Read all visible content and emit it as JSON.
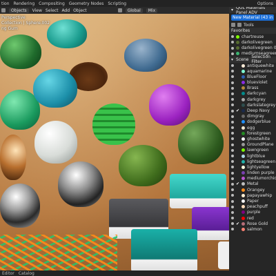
{
  "topbar": {
    "items": [
      "tion",
      "Rendering",
      "Compositing",
      "Geometry Nodes",
      "Scripting"
    ],
    "right": "Options"
  },
  "toolbar": {
    "mode": "Objects",
    "menus": [
      "View",
      "Select",
      "Add",
      "Object"
    ],
    "transform": "Global",
    "pivot": "Mix"
  },
  "viewport": {
    "view_name": "Perspective",
    "collection": "Collection | Sphere.002",
    "extra": "ng Gum"
  },
  "sidebar": {
    "panel_title": "QOL Materials Panel ADV",
    "new_material": "New Material (43 in scene)",
    "tools_label": "Tools",
    "favorites_label": "Favorites",
    "favorites": [
      {
        "name": "chartreuse",
        "color": "#7fff00"
      },
      {
        "name": "darkolivegreen",
        "color": "#556b2f"
      },
      {
        "name": "darkolivegreen 001",
        "color": "#556b2f"
      },
      {
        "name": "mediumseagreen",
        "color": "#3cb371"
      }
    ],
    "scene_label": "Scene",
    "filter_label": "Selection Filter",
    "materials": [
      {
        "name": "antiquewhite",
        "color": "#faebd7",
        "checked": false
      },
      {
        "name": "aquamarine",
        "color": "#7fffd4",
        "checked": false
      },
      {
        "name": "BlueFloor",
        "color": "#2f5fb0",
        "checked": false
      },
      {
        "name": "blueviolet",
        "color": "#8a2be2",
        "checked": false
      },
      {
        "name": "Brass",
        "color": "#b58a3a",
        "checked": false
      },
      {
        "name": "darkcyan",
        "color": "#008b8b",
        "checked": false
      },
      {
        "name": "darkgrey",
        "color": "#a9a9a9",
        "checked": false
      },
      {
        "name": "darkslategrey",
        "color": "#2f4f4f",
        "checked": false
      },
      {
        "name": "Deep Navy",
        "color": "#1b2a4a",
        "checked": true
      },
      {
        "name": "dimgray",
        "color": "#696969",
        "checked": false
      },
      {
        "name": "dodgerblue",
        "color": "#1e90ff",
        "checked": false
      },
      {
        "name": "egg",
        "color": "#efe6cf",
        "checked": false
      },
      {
        "name": "forestgreen",
        "color": "#228b22",
        "checked": false
      },
      {
        "name": "ghostwhite",
        "color": "#f8f8ff",
        "checked": false
      },
      {
        "name": "GroundPlane",
        "color": "#999999",
        "checked": false
      },
      {
        "name": "lawngreen",
        "color": "#7cfc00",
        "checked": false
      },
      {
        "name": "lightblue",
        "color": "#add8e6",
        "checked": false
      },
      {
        "name": "lightseagreen",
        "color": "#20b2aa",
        "checked": false
      },
      {
        "name": "lightyellow",
        "color": "#ffffe0",
        "checked": false
      },
      {
        "name": "linden purple",
        "color": "#7a3fb0",
        "checked": false
      },
      {
        "name": "mediumorchid",
        "color": "#ba55d3",
        "checked": false
      },
      {
        "name": "Metal",
        "color": "#c0c0c0",
        "checked": true
      },
      {
        "name": "Orangey",
        "color": "#ff8c1a",
        "checked": false
      },
      {
        "name": "papayawhip",
        "color": "#ffefd5",
        "checked": false
      },
      {
        "name": "Paper",
        "color": "#f5f5f5",
        "checked": false
      },
      {
        "name": "peachpuff",
        "color": "#ffdab9",
        "checked": false
      },
      {
        "name": "purple",
        "color": "#800080",
        "checked": false
      },
      {
        "name": "red",
        "color": "#ff0000",
        "checked": false
      },
      {
        "name": "Rose Gold",
        "color": "#b76e79",
        "checked": true
      },
      {
        "name": "salmon",
        "color": "#fa8072",
        "checked": false
      }
    ]
  },
  "statusbar": {
    "items": [
      "Editor",
      "Catalog"
    ]
  },
  "colors": {
    "accent": "#1a6ed8",
    "panel_bg": "#262626",
    "wood": "#c28a52"
  }
}
